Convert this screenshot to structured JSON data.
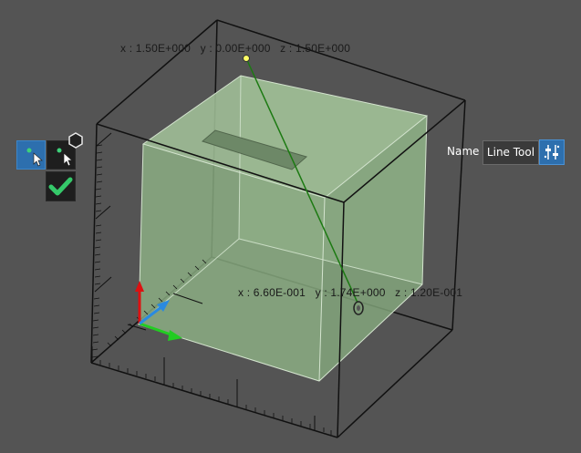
{
  "viewport": {
    "top_point_readout": "x : 1.50E+000   y : 0.00E+000   z : 1.50E+000",
    "probe_readout": "x : 6.60E-001   y : 1.74E+000   z : 1.20E-001"
  },
  "toolbar": {
    "pick_active_icon": "point-pick-cursor-icon",
    "pick_icon": "point-pick-cursor-icon",
    "confirm_icon": "checkmark-icon",
    "hex_icon": "hexagon-icon"
  },
  "name_panel": {
    "label": "Name",
    "value": "Line Tool",
    "settings_icon": "sliders-icon"
  },
  "colors": {
    "background": "#545454",
    "box_fill": "#9dbf95",
    "line": "#1c7a12",
    "accent": "#2d6fae",
    "axis_x": "#22cc22",
    "axis_z": "#dd1111",
    "axis_y": "#2a8ae0"
  }
}
